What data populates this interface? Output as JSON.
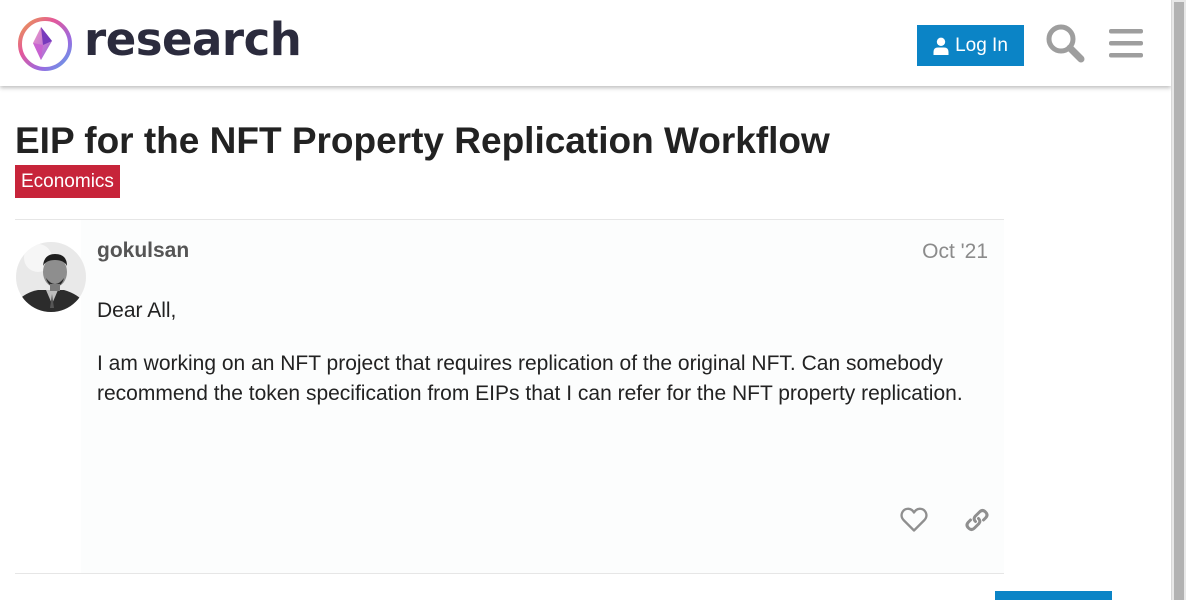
{
  "header": {
    "site_name": "research",
    "login_label": "Log In",
    "icons": [
      "logo-icon",
      "user-icon",
      "search-icon",
      "hamburger-menu-icon"
    ]
  },
  "topic": {
    "title": "EIP for the NFT Property Replication Workflow",
    "category": "Economics",
    "category_color": "#c7243a"
  },
  "post": {
    "username": "gokulsan",
    "date": "Oct '21",
    "paragraphs": [
      "Dear All,",
      "I am working on an NFT project that requires replication of the original NFT. Can somebody recommend the token specification from EIPs that I can refer for the NFT property replication."
    ],
    "actions": [
      "heart-icon",
      "link-icon"
    ]
  },
  "colors": {
    "accent": "#0b84c6",
    "text": "#222222",
    "muted": "#8b8b8b"
  }
}
